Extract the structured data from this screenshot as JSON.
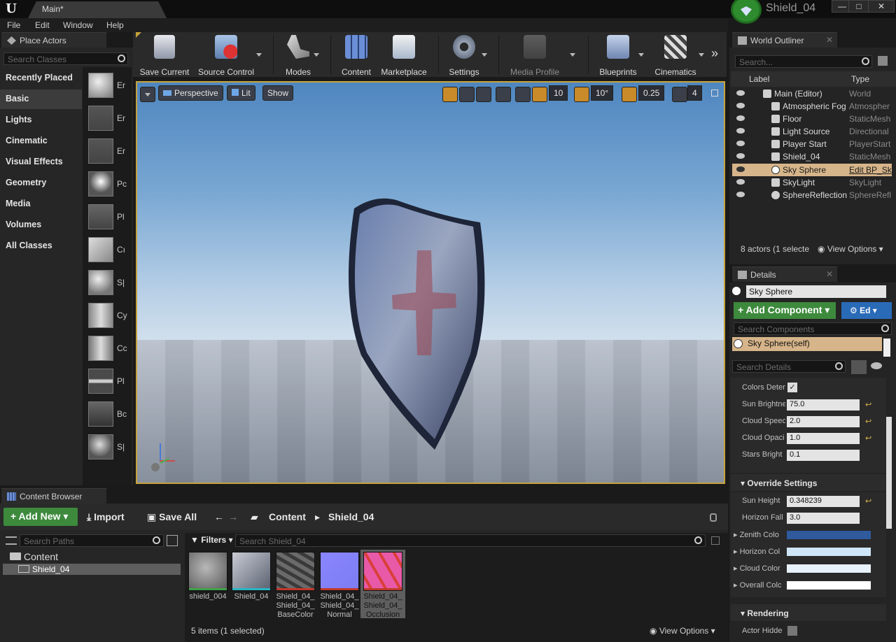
{
  "app": {
    "tab_title": "Main*",
    "project_name": "Shield_04",
    "window_controls": [
      "—",
      "□",
      "✕"
    ]
  },
  "menu": [
    "File",
    "Edit",
    "Window",
    "Help"
  ],
  "place_actors": {
    "title": "Place Actors",
    "search_placeholder": "Search Classes",
    "categories": [
      "Recently Placed",
      "Basic",
      "Lights",
      "Cinematic",
      "Visual Effects",
      "Geometry",
      "Media",
      "Volumes",
      "All Classes"
    ],
    "active_category": "Basic",
    "items": [
      "Er",
      "Er",
      "Er",
      "Pc",
      "Pl",
      "Cı",
      "S|",
      "Cy",
      "Cc",
      "Pl",
      "Bc",
      "S|"
    ]
  },
  "toolbar": {
    "buttons": [
      {
        "label": "Save Current",
        "icon": "save-icon"
      },
      {
        "label": "Source Control",
        "icon": "source-control-icon"
      },
      {
        "label": "Modes",
        "icon": "modes-icon"
      },
      {
        "label": "Content",
        "icon": "content-icon"
      },
      {
        "label": "Marketplace",
        "icon": "marketplace-icon"
      },
      {
        "label": "Settings",
        "icon": "settings-icon"
      },
      {
        "label": "Media Profile",
        "icon": "media-profile-icon"
      },
      {
        "label": "Blueprints",
        "icon": "blueprints-icon"
      },
      {
        "label": "Cinematics",
        "icon": "cinematics-icon"
      }
    ],
    "overflow": "»"
  },
  "viewport": {
    "perspective": "Perspective",
    "lit": "Lit",
    "show": "Show",
    "grid_snap": "10",
    "rotation_snap": "10°",
    "scale_snap": "0.25",
    "camera_speed": "4"
  },
  "content_browser": {
    "title": "Content Browser",
    "add_new": "Add New",
    "import": "Import",
    "save_all": "Save All",
    "breadcrumb": [
      "Content",
      "Shield_04"
    ],
    "search_paths_placeholder": "Search Paths",
    "filters": "Filters",
    "search_assets_placeholder": "Search Shield_04",
    "tree": [
      "Content",
      "Shield_04"
    ],
    "assets": [
      {
        "label": "shield_004",
        "bar": "#3fa34a"
      },
      {
        "label": "Shield_04",
        "bar": "#29b6c4"
      },
      {
        "label": "Shield_04_ Shield_04_ BaseColor",
        "bar": "#c0392b"
      },
      {
        "label": "Shield_04_ Shield_04_ Normal",
        "bar": "#c0392b"
      },
      {
        "label": "Shield_04_ Shield_04_ Occlusion",
        "bar": "#c0392b"
      }
    ],
    "status": "5 items (1 selected)",
    "view_options": "View Options"
  },
  "outliner": {
    "title": "World Outliner",
    "search_placeholder": "Search...",
    "col_label": "Label",
    "col_type": "Type",
    "rows": [
      {
        "name": "Main (Editor)",
        "type": "World"
      },
      {
        "name": "Atmospheric Fog",
        "type": "Atmospher"
      },
      {
        "name": "Floor",
        "type": "StaticMesh"
      },
      {
        "name": "Light Source",
        "type": "Directional"
      },
      {
        "name": "Player Start",
        "type": "PlayerStart"
      },
      {
        "name": "Shield_04",
        "type": "StaticMesh"
      },
      {
        "name": "Sky Sphere",
        "type": "Edit BP_Sk"
      },
      {
        "name": "SkyLight",
        "type": "SkyLight"
      },
      {
        "name": "SphereReflection",
        "type": "SphereRefl"
      }
    ],
    "selected_row": "Sky Sphere",
    "status": "8 actors (1 selecte",
    "view_options": "View Options"
  },
  "details": {
    "title": "Details",
    "object_name": "Sky Sphere",
    "add_component": "Add Component",
    "edit_bp": "Ed",
    "search_components_placeholder": "Search Components",
    "component": "Sky Sphere(self)",
    "search_details_placeholder": "Search Details",
    "props": [
      {
        "label": "Colors Deter",
        "value": ""
      },
      {
        "label": "Sun Brightne",
        "value": "75.0"
      },
      {
        "label": "Cloud Speec",
        "value": "2.0"
      },
      {
        "label": "Cloud Opaci",
        "value": "1.0"
      },
      {
        "label": "Stars Bright",
        "value": "0.1"
      }
    ],
    "override_title": "Override Settings",
    "override_props": [
      {
        "label": "Sun Height",
        "value": "0.348239"
      },
      {
        "label": "Horizon Fall",
        "value": "3.0"
      }
    ],
    "color_props": [
      {
        "label": "Zenith Colo",
        "color": "#2f5a9c"
      },
      {
        "label": "Horizon Col",
        "color": "#cfe6f8"
      },
      {
        "label": "Cloud Color",
        "color": "#e8f2fb"
      },
      {
        "label": "Overall Colc",
        "color": "#ffffff"
      }
    ],
    "rendering_title": "Rendering",
    "actor_hidden": "Actor Hidde",
    "reset_glyph": "↩"
  }
}
